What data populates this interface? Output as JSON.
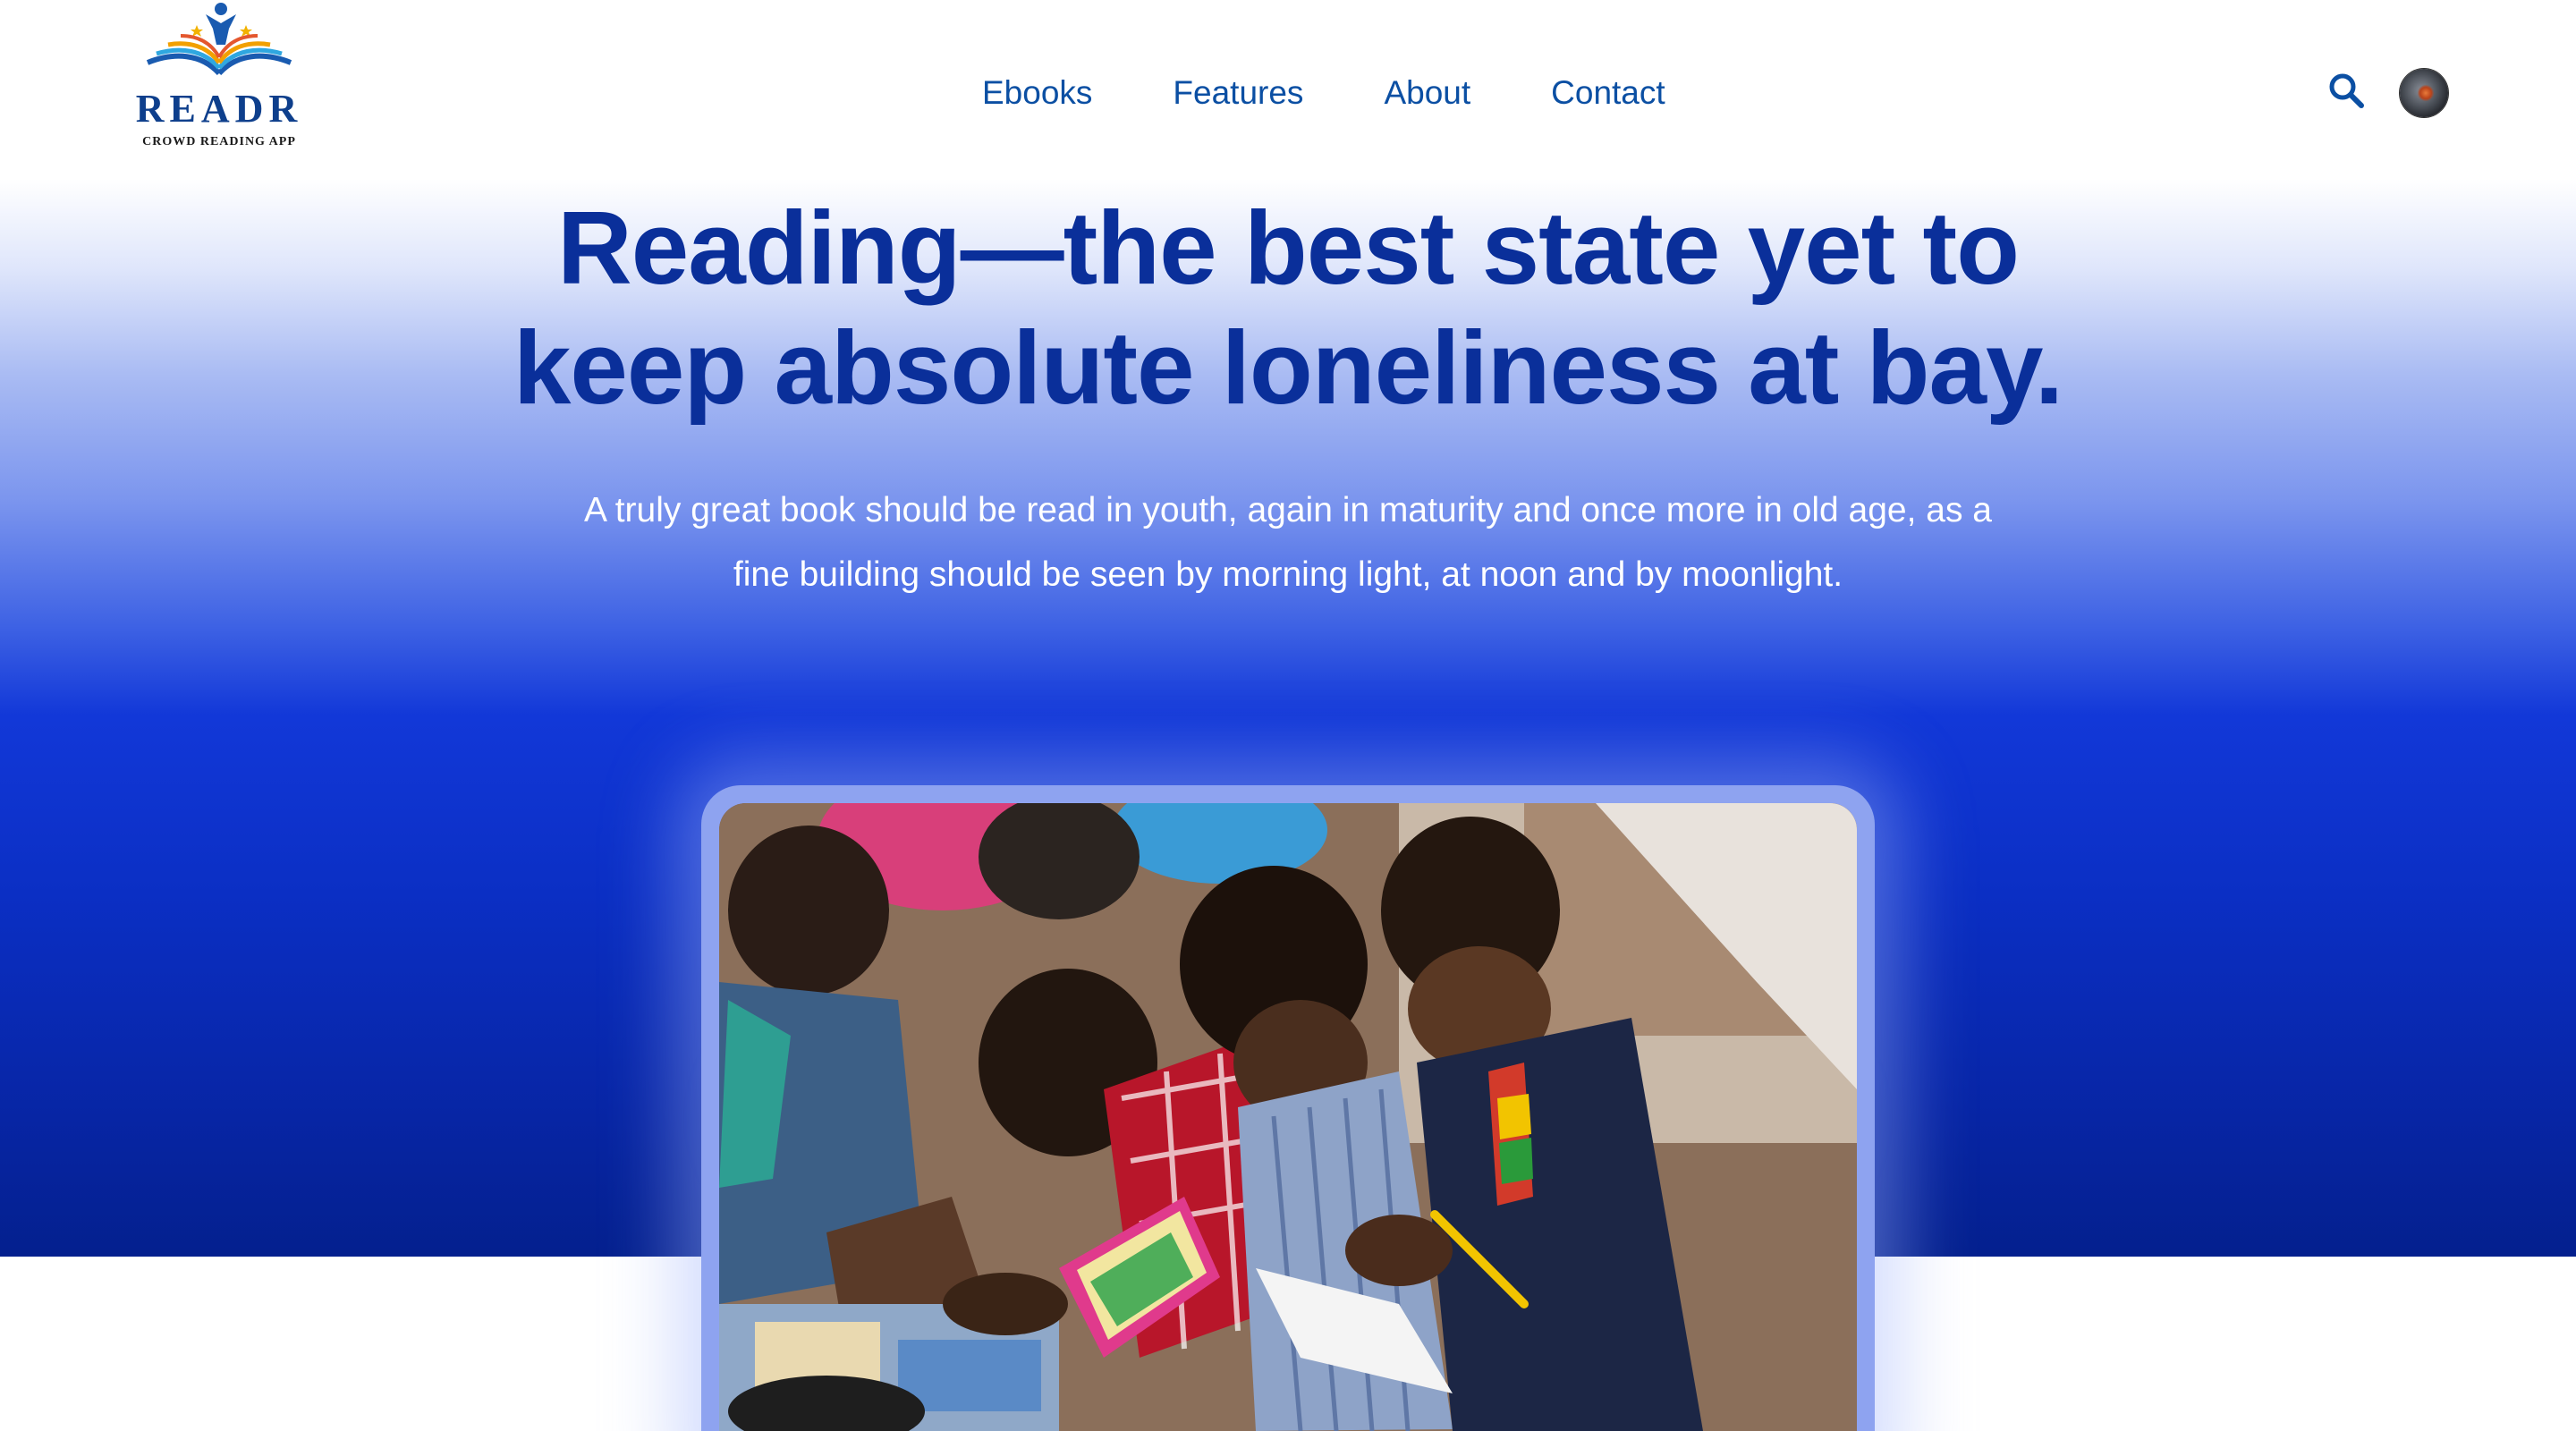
{
  "brand": {
    "name": "READR",
    "tagline": "CROWD READING APP"
  },
  "nav": {
    "items": [
      {
        "label": "Ebooks"
      },
      {
        "label": "Features"
      },
      {
        "label": "About"
      },
      {
        "label": "Contact"
      }
    ]
  },
  "header": {
    "search_icon": "search-icon",
    "avatar": "user-avatar"
  },
  "hero": {
    "headline_line1": "Reading—the best state yet to",
    "headline_line2": "keep absolute loneliness at bay.",
    "subtext": "A truly great book should be read in youth, again in maturity and once more in old age, as a fine building should be seen by morning light, at noon and by moonlight."
  },
  "colors": {
    "brand_blue": "#0b4fa3",
    "headline_blue": "#0a2f9a",
    "hero_deep_blue": "#0b2fc4"
  }
}
